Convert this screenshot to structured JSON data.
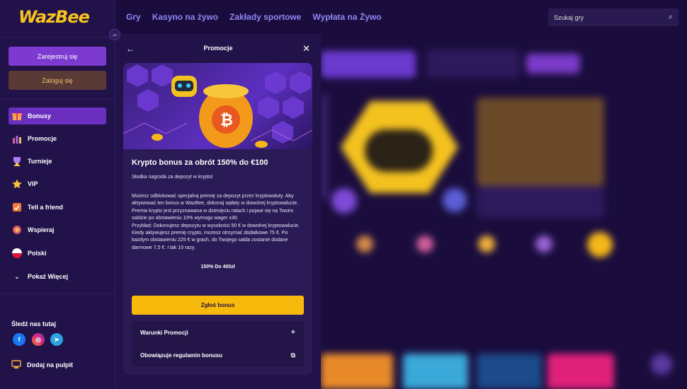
{
  "brand": {
    "logo_text": "WazBee",
    "accent": "#f7c41c",
    "primary": "#7c3ad0"
  },
  "topnav": [
    "Gry",
    "Kasyno na żywo",
    "Zakłady sportowe",
    "Wypłata na Żywo"
  ],
  "search": {
    "placeholder": "Szukaj gry",
    "icon": "search-icon"
  },
  "sidebar": {
    "collapse_icon": "collapse-icon",
    "register_label": "Zarejestruj się",
    "login_label": "Zaloguj się",
    "items": [
      {
        "label": "Bonusy",
        "icon": "gift-icon",
        "active": true
      },
      {
        "label": "Promocje",
        "icon": "promotions-icon"
      },
      {
        "label": "Turnieje",
        "icon": "trophy-icon"
      },
      {
        "label": "VIP",
        "icon": "star-icon"
      },
      {
        "label": "Tell a friend",
        "icon": "share-icon"
      },
      {
        "label": "Wspieraj",
        "icon": "support-icon"
      },
      {
        "label": "Polski",
        "icon": "poland-flag-icon"
      },
      {
        "label": "Pokaż Więcej",
        "icon": "chevron-down-icon"
      }
    ],
    "follow_title": "Śledź nas tutaj",
    "socials": [
      "facebook-icon",
      "instagram-icon",
      "telegram-icon"
    ],
    "add_desktop": "Dodaj na pulpit"
  },
  "panel": {
    "title": "Promocje",
    "card": {
      "title": "Krypto bonus za obrót 150% do €100",
      "subtitle": "Słodka nagroda za depozyt w krypto!",
      "body": [
        "Możesz odblokować specjalną premię za depozyt przez kryptowaluty. Aby aktywować ten bonus w WazBee, dokonaj wpłaty w dowolnej kryptowalucie.",
        "Premia krypto jest przyznawana w dziesięciu ratach i pojawi się na Twoim saldzie po obstawieniu 10% wymogu wager x30.",
        "Przykład: Dokonujesz depozytu w wysokości 50 € w dowolnej kryptowalucie. Kiedy aktywujesz premię crypto, możesz otrzymać dodatkowe 75 €. Po każdym obstawieniu 225 € w grach, do Twojego salda zostanie dodane darmowe 7,5 €. I tak 10 razy."
      ],
      "caption": "150% Do 400zł",
      "claim_label": "Zgłoś bonus",
      "accordion": [
        {
          "label": "Warunki Promocji",
          "icon": "plus-icon"
        },
        {
          "label": "Obowiązuje regulamin bonusu",
          "icon": "external-link-icon"
        }
      ]
    }
  }
}
